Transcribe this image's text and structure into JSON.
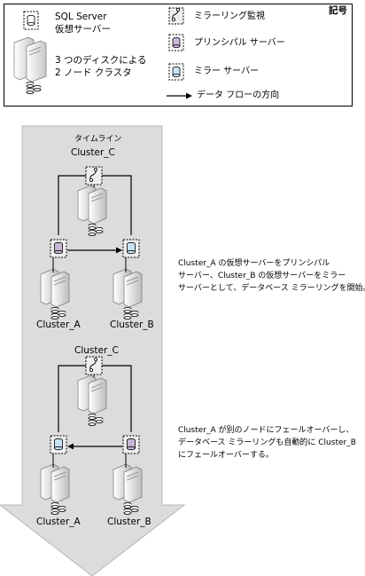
{
  "legend": {
    "title": "記号",
    "sql_server_line1": "SQL Server",
    "sql_server_line2": "仮想サーバー",
    "cluster_line1": "3 つのディスクによる",
    "cluster_line2": "2 ノード クラスタ",
    "mirroring_monitor": "ミラーリング監視",
    "principal_server": "プリンシパル サーバー",
    "mirror_server": "ミラー サーバー",
    "data_flow": "データ フローの方向"
  },
  "timeline": {
    "label": "タイムライン",
    "top": {
      "witness_cluster": "Cluster_C",
      "left_cluster": "Cluster_A",
      "right_cluster": "Cluster_B"
    },
    "bottom": {
      "witness_cluster": "Cluster_C",
      "left_cluster": "Cluster_A",
      "right_cluster": "Cluster_B"
    }
  },
  "notes": {
    "note1_line1": "Cluster_A の仮想サーバーをプリンシパル",
    "note1_line2": "サーバー、Cluster_B の仮想サーバーをミラー",
    "note1_line3": "サーバーとして、データベース ミラーリングを開始。",
    "note2_line1": "Cluster_A が別のノードにフェールオーバーし、",
    "note2_line2": "データベース ミラーリングも自動的に Cluster_B",
    "note2_line3": "にフェールオーバーする。"
  },
  "colors": {
    "arrow_band": "#dcdcdc",
    "principal_db": "#c8b8d8",
    "mirror_db": "#c8e4f4",
    "server_body": "#e8e8e8"
  }
}
